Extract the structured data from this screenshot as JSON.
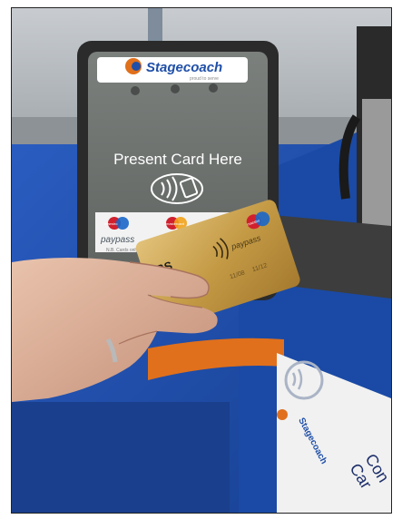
{
  "reader": {
    "brand": "Stagecoach",
    "tagline": "proud to serve",
    "prompt": "Present Card Here",
    "logos": [
      {
        "top": "maestro",
        "bottom": "paypass"
      },
      {
        "top": "mastercard",
        "bottom": "paypass"
      }
    ],
    "fine_print": "N.B. Cards only",
    "indicator_lights": 3
  },
  "card": {
    "issuer": "RBS",
    "brand_badge": "maestro",
    "contactless": "paypass",
    "date_fields": [
      "11/08",
      "11/12"
    ]
  },
  "bus_panel": {
    "brand": "Stagecoach",
    "lines": [
      "Con",
      "Car"
    ]
  },
  "colors": {
    "reader_body": "#2b2b2b",
    "reader_face": "#6f7370",
    "card_gold": "#c9a24a",
    "bus_blue": "#1f4fa8",
    "orange_rail": "#e0701c"
  }
}
